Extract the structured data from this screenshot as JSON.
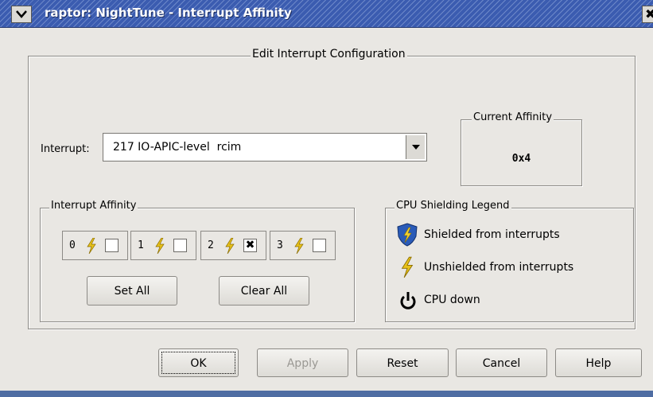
{
  "window": {
    "title": "raptor: NightTune - Interrupt Affinity",
    "close_glyph": "✖"
  },
  "edit_group": {
    "title": "Edit Interrupt Configuration",
    "interrupt_label": "Interrupt:",
    "interrupt_value": "217 IO-APIC-level  rcim"
  },
  "current_affinity": {
    "title": "Current Affinity",
    "value": "0x4"
  },
  "interrupt_affinity": {
    "title": "Interrupt Affinity",
    "cpus": [
      {
        "num": "0",
        "checked": false,
        "mark": ""
      },
      {
        "num": "1",
        "checked": false,
        "mark": ""
      },
      {
        "num": "2",
        "checked": true,
        "mark": "✖"
      },
      {
        "num": "3",
        "checked": false,
        "mark": ""
      }
    ],
    "set_all": "Set All",
    "clear_all": "Clear All"
  },
  "legend": {
    "title": "CPU Shielding Legend",
    "shielded": "Shielded from interrupts",
    "unshielded": "Unshielded from interrupts",
    "down": "CPU down"
  },
  "buttons": {
    "ok": "OK",
    "apply": "Apply",
    "reset": "Reset",
    "cancel": "Cancel",
    "help": "Help"
  },
  "colors": {
    "titlebar": "#3b5cb0",
    "dialog_bg": "#e9e7e3",
    "bolt": "#e8c21a",
    "shield": "#2a5bb8"
  }
}
